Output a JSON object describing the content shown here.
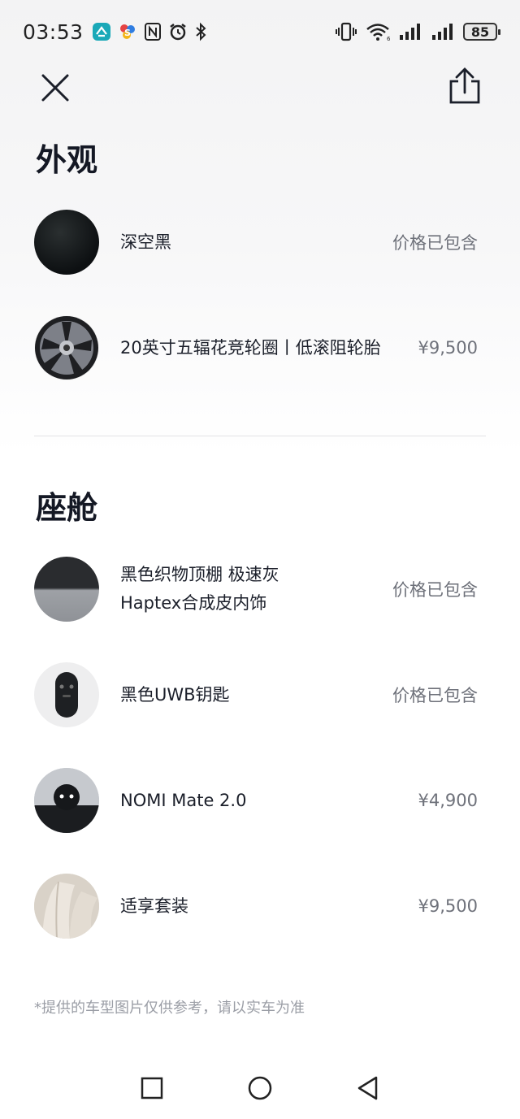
{
  "status_bar": {
    "time": "03:53",
    "left_icons": [
      "nio-app-icon",
      "share-app-icon",
      "nfc-icon",
      "alarm-icon",
      "bluetooth-icon"
    ],
    "right_icons": [
      "vibrate-icon",
      "wifi-icon",
      "signal-icon",
      "signal-icon-2"
    ],
    "battery": "85"
  },
  "sections": {
    "exterior": {
      "title": "外观",
      "items": [
        {
          "name": "深空黑",
          "price": "价格已包含",
          "icon": "paint-swatch"
        },
        {
          "name": "20英寸五辐花竞轮圈丨低滚阻轮胎",
          "price": "¥9,500",
          "icon": "wheel-image"
        }
      ]
    },
    "cabin": {
      "title": "座舱",
      "items": [
        {
          "name": "黑色织物顶棚 极速灰Haptex合成皮内饰",
          "price": "价格已包含",
          "icon": "interior-swatch"
        },
        {
          "name": "黑色UWB钥匙",
          "price": "价格已包含",
          "icon": "key-image"
        },
        {
          "name": "NOMI Mate 2.0",
          "price": "¥4,900",
          "icon": "nomi-image"
        },
        {
          "name": "适享套装",
          "price": "¥9,500",
          "icon": "seat-image"
        }
      ]
    }
  },
  "disclaimer": "*提供的车型图片仅供参考，请以实车为准",
  "colors": {
    "text_primary": "#1b1f2a",
    "text_secondary": "#6e717a",
    "disclaimer": "#9b9ea6"
  }
}
